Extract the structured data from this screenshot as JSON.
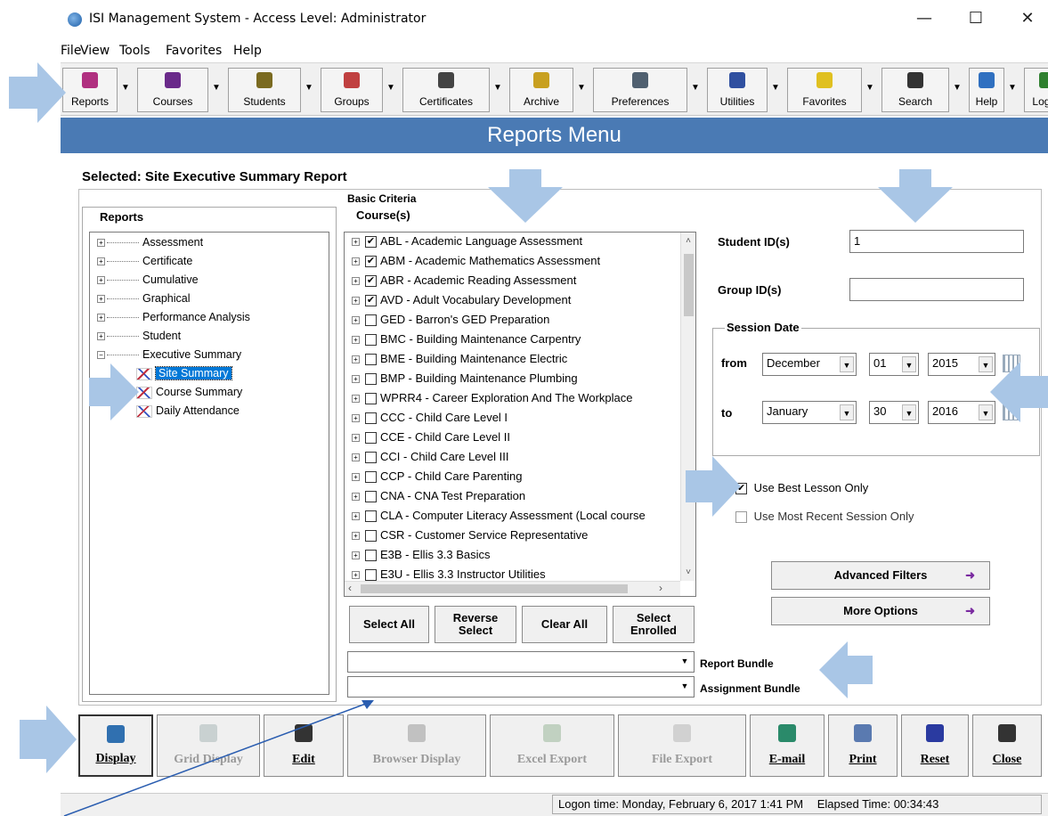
{
  "window": {
    "title": "ISI Management System - Access Level: Administrator",
    "minimize": "—",
    "maximize": "☐",
    "close": "✕"
  },
  "menu": [
    {
      "label": "File"
    },
    {
      "label": "View"
    },
    {
      "label": "Tools"
    },
    {
      "label": "Favorites"
    },
    {
      "label": "Help"
    }
  ],
  "toolbar": [
    {
      "label": "Reports",
      "icon": "reports-icon",
      "color": "#b03080"
    },
    {
      "label": "Courses",
      "icon": "courses-icon",
      "color": "#6a2a8a"
    },
    {
      "label": "Students",
      "icon": "students-icon",
      "color": "#7a6a20"
    },
    {
      "label": "Groups",
      "icon": "groups-icon",
      "color": "#c04040"
    },
    {
      "label": "Certificates",
      "icon": "certificates-icon",
      "color": "#444444"
    },
    {
      "label": "Archive",
      "icon": "archive-icon",
      "color": "#c8a020"
    },
    {
      "label": "Preferences",
      "icon": "preferences-icon",
      "color": "#506070"
    },
    {
      "label": "Utilities",
      "icon": "utilities-icon",
      "color": "#3050a0"
    },
    {
      "label": "Favorites",
      "icon": "star-icon",
      "color": "#e0c020"
    },
    {
      "label": "Search",
      "icon": "binoculars-icon",
      "color": "#333333"
    },
    {
      "label": "Help",
      "icon": "help-icon",
      "color": "#3070c0"
    },
    {
      "label": "Logoff",
      "icon": "logoff-icon",
      "color": "#308030"
    }
  ],
  "header": {
    "title": "Reports Menu",
    "color": "#4a7ab4"
  },
  "selected": {
    "label": "Selected: Site Executive Summary Report"
  },
  "reports_panel": {
    "title": "Reports",
    "tree": [
      {
        "label": "Assessment",
        "level": 0
      },
      {
        "label": "Certificate",
        "level": 0
      },
      {
        "label": "Cumulative",
        "level": 0
      },
      {
        "label": "Graphical",
        "level": 0
      },
      {
        "label": "Performance Analysis",
        "level": 0
      },
      {
        "label": "Student",
        "level": 0
      },
      {
        "label": "Executive Summary",
        "level": 0,
        "expanded": true
      },
      {
        "label": "Site Summary",
        "level": 1,
        "selected": true
      },
      {
        "label": "Course Summary",
        "level": 1
      },
      {
        "label": "Daily Attendance",
        "level": 1
      }
    ]
  },
  "criteria": {
    "title": "Basic Criteria",
    "courses_label": "Course(s)",
    "courses": [
      {
        "label": "ABL - Academic Language Assessment",
        "checked": true
      },
      {
        "label": "ABM - Academic Mathematics Assessment",
        "checked": true
      },
      {
        "label": "ABR - Academic Reading Assessment",
        "checked": true
      },
      {
        "label": "AVD - Adult Vocabulary Development",
        "checked": true
      },
      {
        "label": "GED - Barron's GED Preparation",
        "checked": false
      },
      {
        "label": "BMC - Building Maintenance Carpentry",
        "checked": false
      },
      {
        "label": "BME - Building Maintenance Electric",
        "checked": false
      },
      {
        "label": "BMP - Building Maintenance Plumbing",
        "checked": false
      },
      {
        "label": "WPRR4 - Career Exploration And The Workplace",
        "checked": false
      },
      {
        "label": "CCC - Child Care Level I",
        "checked": false
      },
      {
        "label": "CCE - Child Care Level II",
        "checked": false
      },
      {
        "label": "CCI - Child Care Level III",
        "checked": false
      },
      {
        "label": "CCP - Child Care Parenting",
        "checked": false
      },
      {
        "label": "CNA - CNA Test Preparation",
        "checked": false
      },
      {
        "label": "CLA - Computer Literacy Assessment (Local course",
        "checked": false
      },
      {
        "label": "CSR - Customer Service Representative",
        "checked": false
      },
      {
        "label": "E3B - Ellis 3.3 Basics",
        "checked": false
      },
      {
        "label": "E3U - Ellis 3.3 Instructor Utilities",
        "checked": false
      }
    ],
    "buttons": {
      "select_all": "Select All",
      "reverse_select": "Reverse Select",
      "clear_all": "Clear All",
      "select_enrolled": "Select Enrolled"
    },
    "report_bundle_label": "Report Bundle",
    "assignment_bundle_label": "Assignment Bundle",
    "report_bundle_value": "",
    "assignment_bundle_value": ""
  },
  "right": {
    "student_ids_label": "Student ID(s)",
    "student_ids_value": "1",
    "group_ids_label": "Group ID(s)",
    "group_ids_value": "",
    "session_date_label": "Session Date",
    "from_label": "from",
    "from_month": "December",
    "from_day": "01",
    "from_year": "2015",
    "to_label": "to",
    "to_month": "January",
    "to_day": "30",
    "to_year": "2016",
    "use_best_lesson": "Use Best Lesson Only",
    "use_best_lesson_checked": true,
    "use_most_recent": "Use Most Recent Session Only",
    "use_most_recent_checked": false,
    "advanced_filters": "Advanced Filters",
    "more_options": "More Options"
  },
  "bottom_buttons": [
    {
      "label": "Display",
      "icon": "display-icon",
      "enabled": true
    },
    {
      "label": "Grid Display",
      "icon": "grid-icon",
      "enabled": false
    },
    {
      "label": "Edit",
      "icon": "pencil-icon",
      "enabled": true
    },
    {
      "label": "Browser Display",
      "icon": "globe-icon",
      "enabled": false
    },
    {
      "label": "Excel Export",
      "icon": "excel-icon",
      "enabled": false
    },
    {
      "label": "File Export",
      "icon": "file-export-icon",
      "enabled": false
    },
    {
      "label": "E-mail",
      "icon": "email-icon",
      "enabled": true
    },
    {
      "label": "Print",
      "icon": "printer-icon",
      "enabled": true
    },
    {
      "label": "Reset",
      "icon": "reset-icon",
      "enabled": true
    },
    {
      "label": "Close",
      "icon": "close-door-icon",
      "enabled": true
    }
  ],
  "status": {
    "logon_time": "Logon time: Monday, February 6, 2017 1:41 PM",
    "elapsed": "Elapsed Time: 00:34:43"
  }
}
